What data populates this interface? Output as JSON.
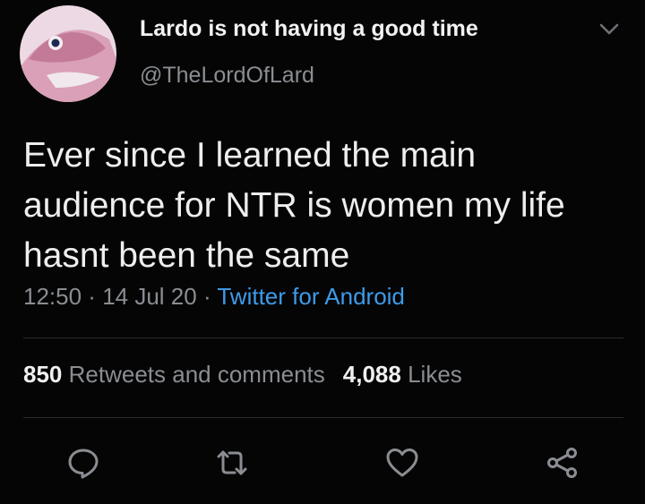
{
  "author": {
    "display_name": "Lardo is not having a good time",
    "handle": "@TheLordOfLard",
    "avatar_icon": "pink-creature-avatar"
  },
  "tweet": {
    "text": "Ever since I learned the main audience for NTR is women my life hasnt been the same",
    "time": "12:50",
    "separator": " · ",
    "date": "14 Jul 20",
    "source": "Twitter for Android"
  },
  "stats": {
    "retweets_count": "850",
    "retweets_label": "Retweets and comments",
    "likes_count": "4,088",
    "likes_label": "Likes"
  },
  "actions": {
    "reply_icon": "reply-icon",
    "retweet_icon": "retweet-icon",
    "like_icon": "heart-icon",
    "share_icon": "share-icon"
  },
  "colors": {
    "background": "#050505",
    "text": "#eeeeee",
    "muted": "#8a8d91",
    "link": "#3d9be9"
  }
}
